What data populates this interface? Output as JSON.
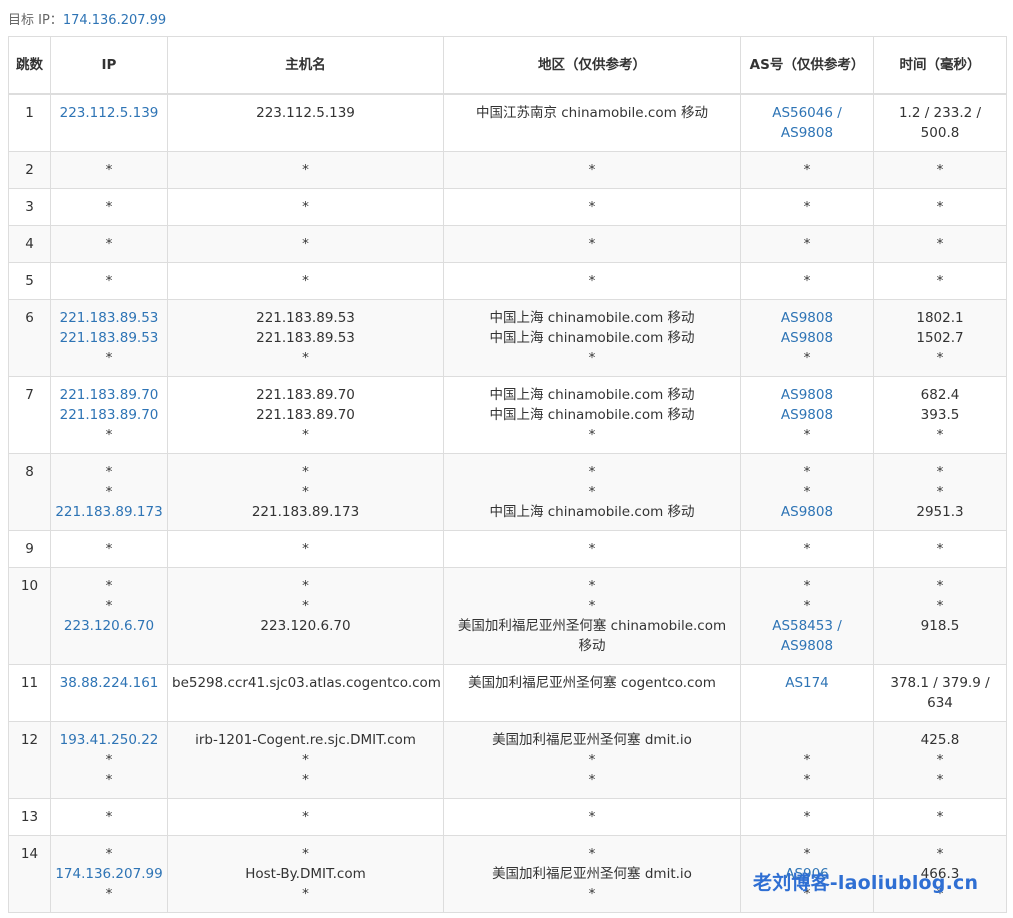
{
  "target": {
    "label": "目标 IP：",
    "ip": "174.136.207.99"
  },
  "headers": {
    "hop": "跳数",
    "ip": "IP",
    "host": "主机名",
    "location": "地区（仅供参考）",
    "as": "AS号（仅供参考）",
    "time": "时间（毫秒）"
  },
  "rows": [
    {
      "hop": "1",
      "ip": [
        "223.112.5.139"
      ],
      "host": [
        "223.112.5.139"
      ],
      "location": [
        "中国江苏南京 chinamobile.com 移动"
      ],
      "as": [
        "AS56046 /",
        "AS9808"
      ],
      "time": [
        "1.2 / 233.2 /",
        "500.8"
      ]
    },
    {
      "hop": "2",
      "ip": [
        "*"
      ],
      "host": [
        "*"
      ],
      "location": [
        "*"
      ],
      "as": [
        "*"
      ],
      "time": [
        "*"
      ]
    },
    {
      "hop": "3",
      "ip": [
        "*"
      ],
      "host": [
        "*"
      ],
      "location": [
        "*"
      ],
      "as": [
        "*"
      ],
      "time": [
        "*"
      ]
    },
    {
      "hop": "4",
      "ip": [
        "*"
      ],
      "host": [
        "*"
      ],
      "location": [
        "*"
      ],
      "as": [
        "*"
      ],
      "time": [
        "*"
      ]
    },
    {
      "hop": "5",
      "ip": [
        "*"
      ],
      "host": [
        "*"
      ],
      "location": [
        "*"
      ],
      "as": [
        "*"
      ],
      "time": [
        "*"
      ]
    },
    {
      "hop": "6",
      "ip": [
        "221.183.89.53",
        "221.183.89.53",
        "*"
      ],
      "host": [
        "221.183.89.53",
        "221.183.89.53",
        "*"
      ],
      "location": [
        "中国上海 chinamobile.com 移动",
        "中国上海 chinamobile.com 移动",
        "*"
      ],
      "as": [
        "AS9808",
        "AS9808",
        "*"
      ],
      "time": [
        "1802.1",
        "1502.7",
        "*"
      ]
    },
    {
      "hop": "7",
      "ip": [
        "221.183.89.70",
        "221.183.89.70",
        "*"
      ],
      "host": [
        "221.183.89.70",
        "221.183.89.70",
        "*"
      ],
      "location": [
        "中国上海 chinamobile.com 移动",
        "中国上海 chinamobile.com 移动",
        "*"
      ],
      "as": [
        "AS9808",
        "AS9808",
        "*"
      ],
      "time": [
        "682.4",
        "393.5",
        "*"
      ]
    },
    {
      "hop": "8",
      "ip": [
        "*",
        "*",
        "221.183.89.173"
      ],
      "host": [
        "*",
        "*",
        "221.183.89.173"
      ],
      "location": [
        "*",
        "*",
        "中国上海 chinamobile.com 移动"
      ],
      "as": [
        "*",
        "*",
        "AS9808"
      ],
      "time": [
        "*",
        "*",
        "2951.3"
      ]
    },
    {
      "hop": "9",
      "ip": [
        "*"
      ],
      "host": [
        "*"
      ],
      "location": [
        "*"
      ],
      "as": [
        "*"
      ],
      "time": [
        "*"
      ]
    },
    {
      "hop": "10",
      "ip": [
        "*",
        "*",
        "223.120.6.70"
      ],
      "host": [
        "*",
        "*",
        "223.120.6.70"
      ],
      "location": [
        "*",
        "*",
        "美国加利福尼亚州圣何塞 chinamobile.com",
        "移动"
      ],
      "as": [
        "*",
        "*",
        "AS58453 /",
        "AS9808"
      ],
      "time": [
        "*",
        "*",
        "918.5"
      ]
    },
    {
      "hop": "11",
      "ip": [
        "38.88.224.161"
      ],
      "host": [
        "be5298.ccr41.sjc03.atlas.cogentco.com"
      ],
      "location": [
        "美国加利福尼亚州圣何塞 cogentco.com"
      ],
      "as": [
        "AS174"
      ],
      "time": [
        "378.1 / 379.9 /",
        "634"
      ]
    },
    {
      "hop": "12",
      "ip": [
        "193.41.250.22",
        "*",
        "*"
      ],
      "host": [
        "irb-1201-Cogent.re.sjc.DMIT.com",
        "*",
        "*"
      ],
      "location": [
        "美国加利福尼亚州圣何塞 dmit.io",
        "*",
        "*"
      ],
      "as": [
        "",
        "*",
        "*"
      ],
      "time": [
        "425.8",
        "*",
        "*"
      ]
    },
    {
      "hop": "13",
      "ip": [
        "*"
      ],
      "host": [
        "*"
      ],
      "location": [
        "*"
      ],
      "as": [
        "*"
      ],
      "time": [
        "*"
      ]
    },
    {
      "hop": "14",
      "ip": [
        "*",
        "174.136.207.99",
        "*"
      ],
      "host": [
        "*",
        "Host-By.DMIT.com",
        "*"
      ],
      "location": [
        "*",
        "美国加利福尼亚州圣何塞 dmit.io",
        "*"
      ],
      "as": [
        "*",
        "AS906",
        "*"
      ],
      "time": [
        "*",
        "466.3",
        "*"
      ]
    }
  ],
  "watermark": "老刘博客-laoliublog.cn",
  "colors": {
    "link": "#2e74b5",
    "border": "#dddddd",
    "stripe": "#f9f9f9",
    "watermark": "#2f6fd3"
  }
}
